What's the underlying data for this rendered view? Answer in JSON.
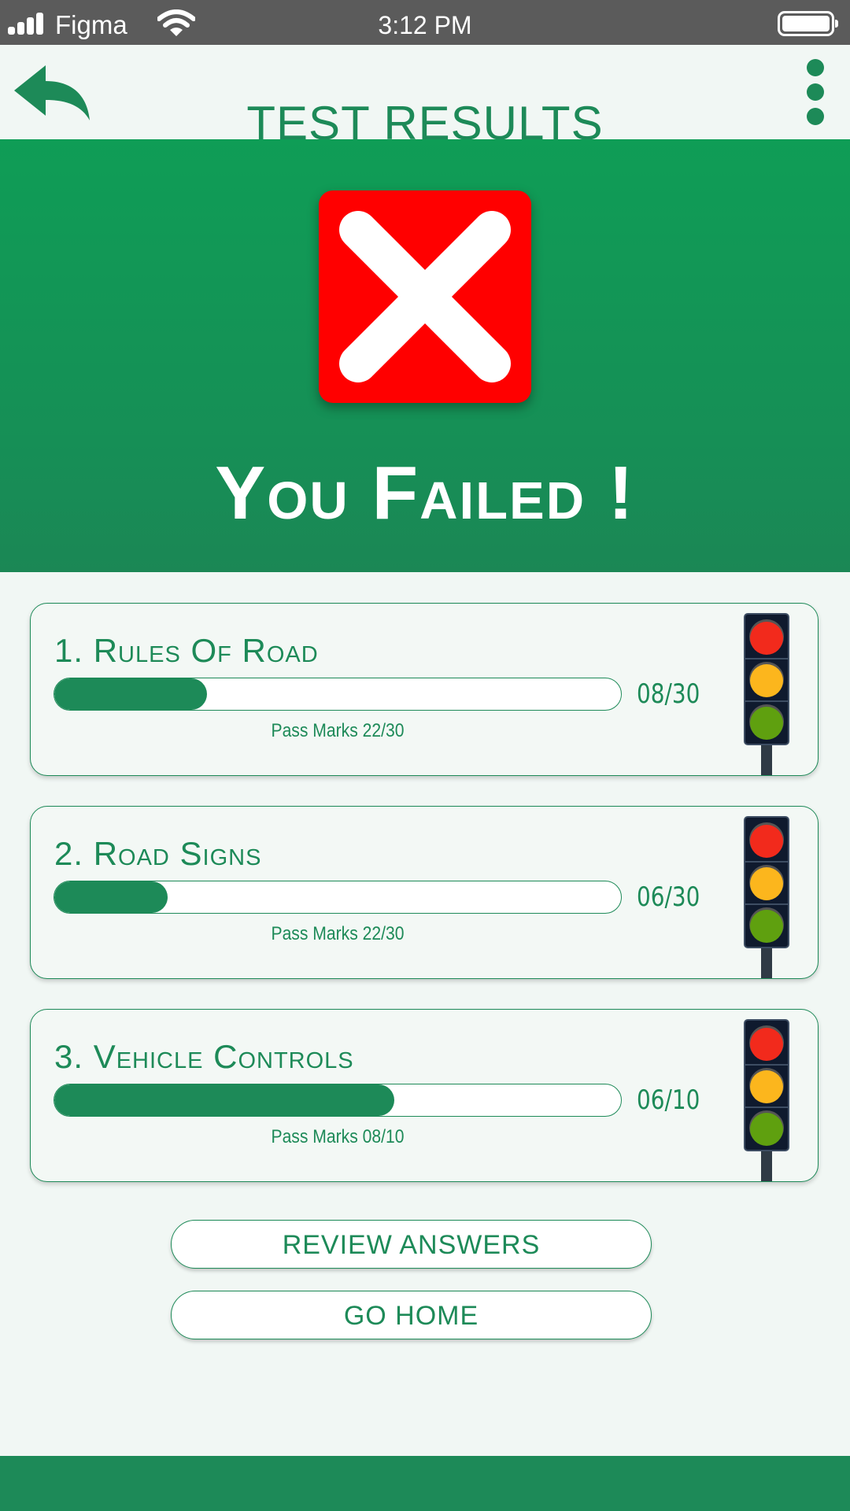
{
  "status_bar": {
    "carrier": "Figma",
    "time": "3:12 PM",
    "signal_icon": "signal-bars-icon",
    "wifi_icon": "wifi-icon",
    "battery_icon": "battery-icon"
  },
  "header": {
    "title": "TEST RESULTS",
    "back_icon": "back-arrow-icon",
    "menu_icon": "more-vertical-icon"
  },
  "result": {
    "icon": "red-x-icon",
    "title": "You Failed !"
  },
  "sections": [
    {
      "title": "1. Rules Of Road",
      "score": "08/30",
      "progress": 0.27,
      "pass_marks": "Pass Marks 22/30",
      "icon": "traffic-light-icon"
    },
    {
      "title": "2. Road Signs",
      "score": "06/30",
      "progress": 0.2,
      "pass_marks": "Pass Marks 22/30",
      "icon": "traffic-light-icon"
    },
    {
      "title": "3. Vehicle Controls",
      "score": "06/10",
      "progress": 0.6,
      "pass_marks": "Pass Marks 08/10",
      "icon": "traffic-light-icon"
    }
  ],
  "actions": {
    "review_label": "REVIEW ANSWERS",
    "home_label": "GO HOME"
  },
  "colors": {
    "accent": "#1d8a58",
    "hero": "#0f9d56",
    "fail": "#ff0000"
  }
}
